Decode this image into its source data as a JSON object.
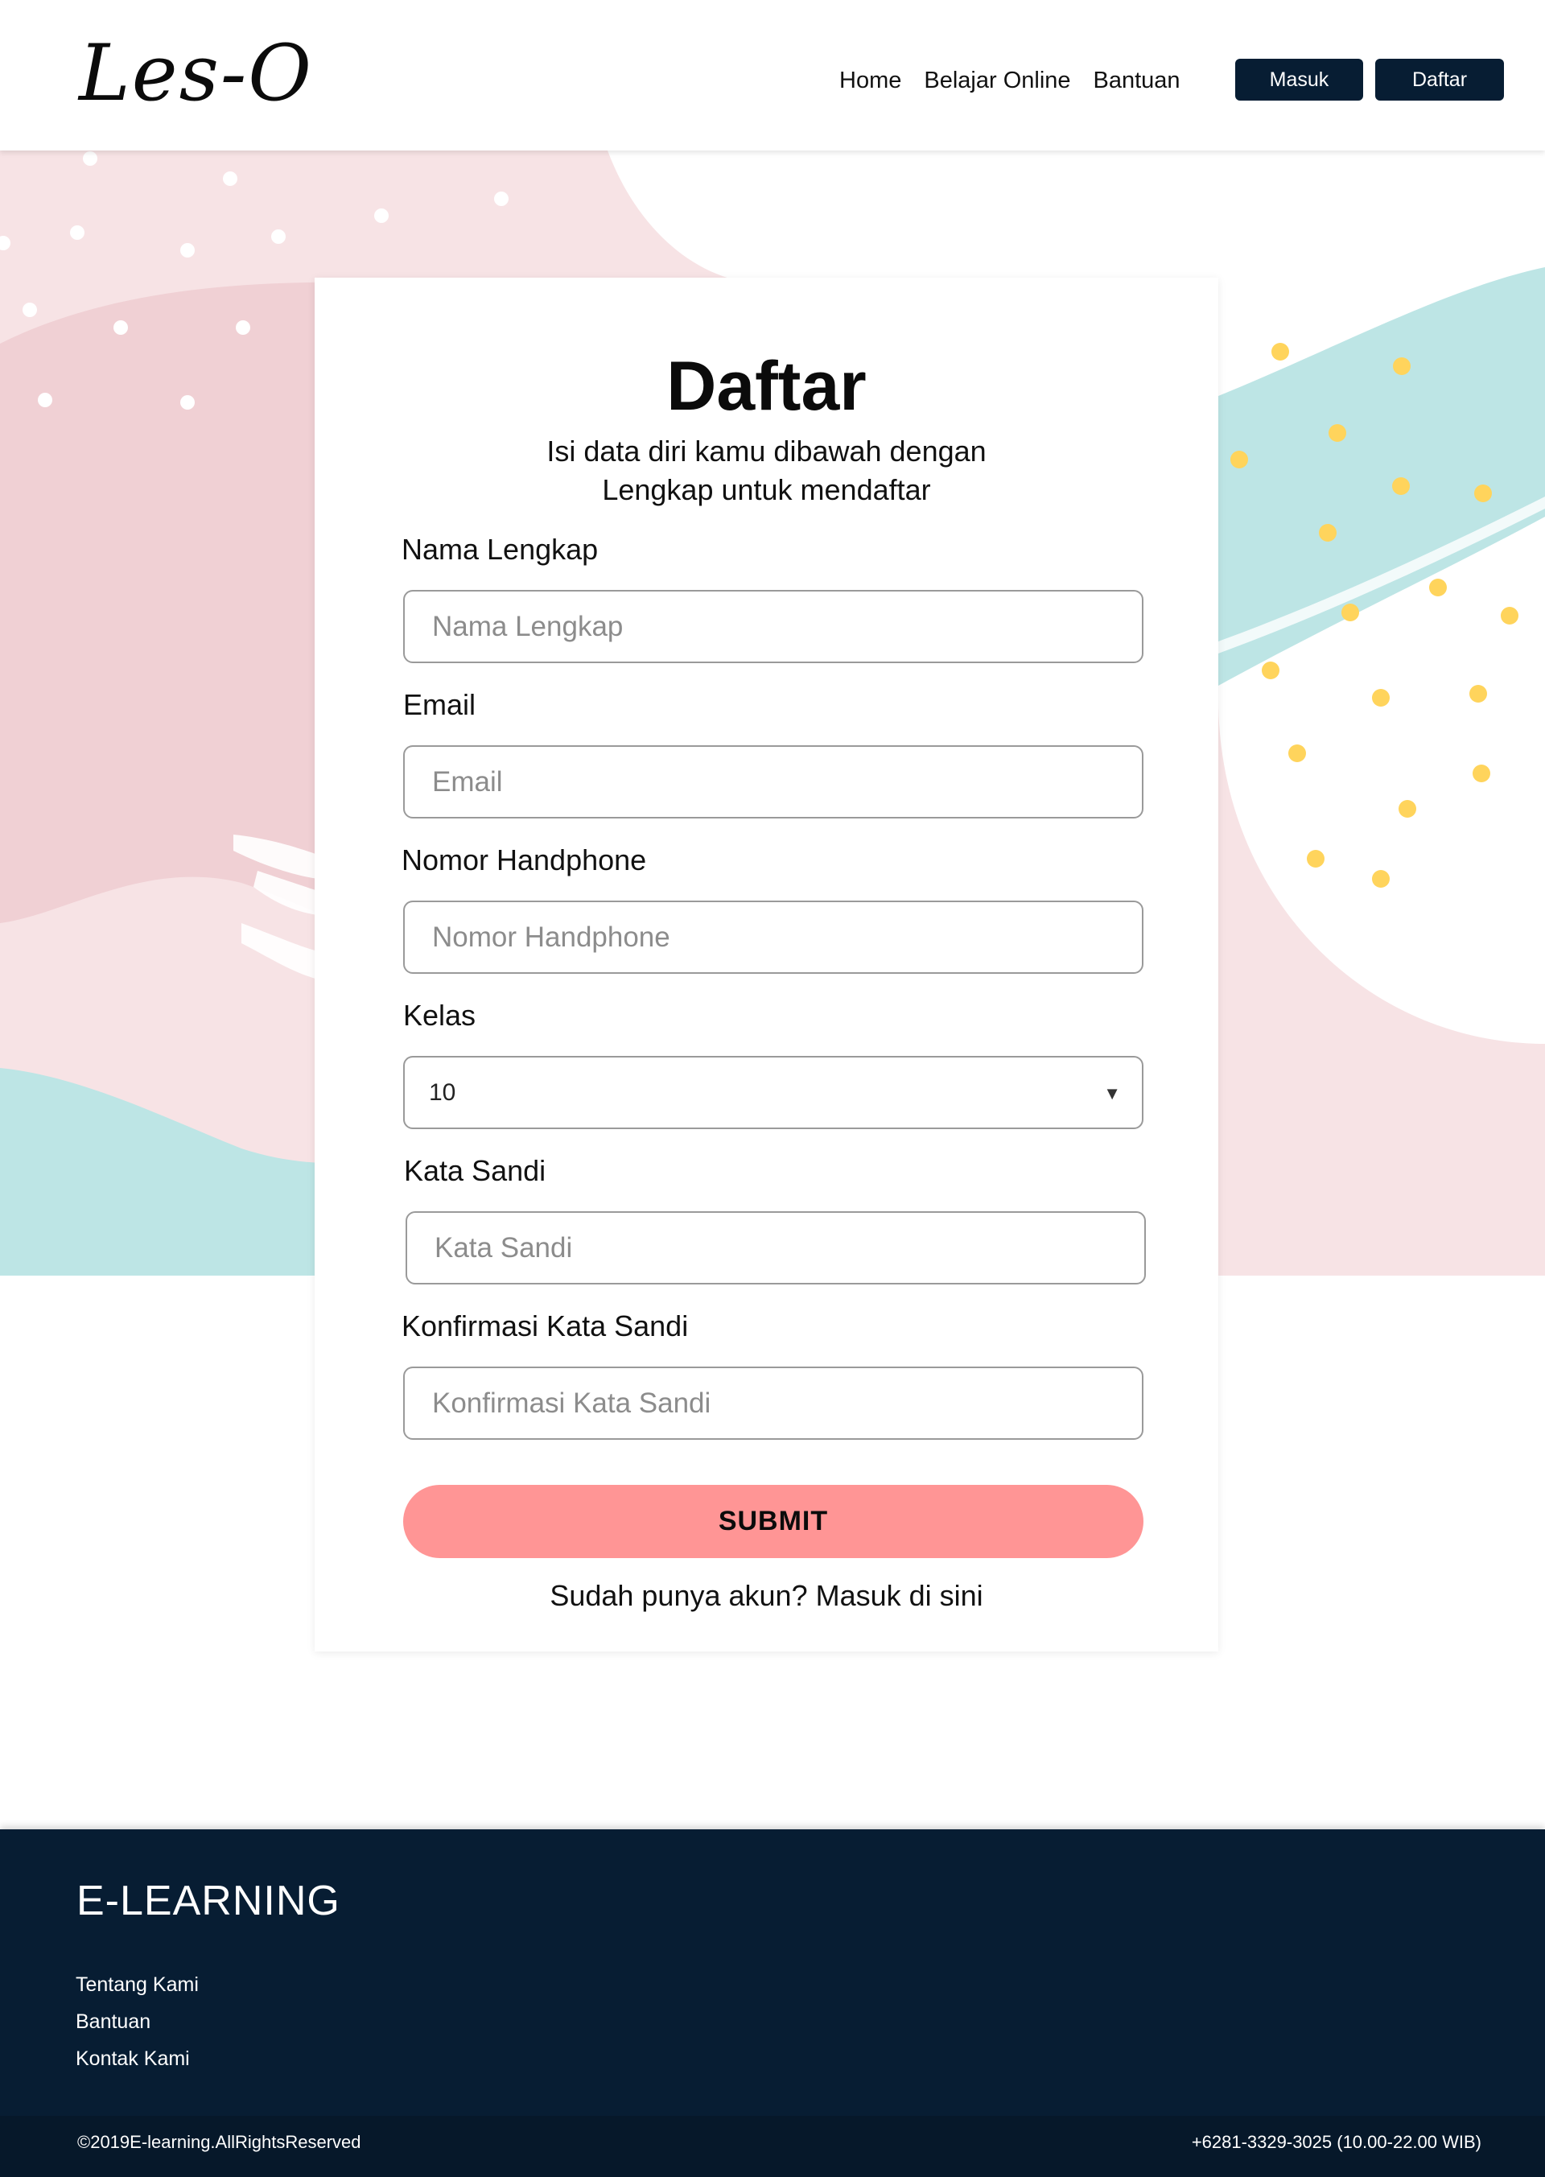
{
  "header": {
    "logo": "Les-O",
    "nav": [
      "Home",
      "Belajar Online",
      "Bantuan"
    ],
    "login_button": "Masuk",
    "register_button": "Daftar"
  },
  "form": {
    "title": "Daftar",
    "subtitle_line1": "Isi data diri kamu dibawah dengan",
    "subtitle_line2": "Lengkap untuk mendaftar",
    "fields": {
      "name": {
        "label": "Nama Lengkap",
        "placeholder": "Nama Lengkap",
        "value": ""
      },
      "email": {
        "label": "Email",
        "placeholder": "Email",
        "value": ""
      },
      "phone": {
        "label": "Nomor Handphone",
        "placeholder": "Nomor Handphone",
        "value": ""
      },
      "class": {
        "label": "Kelas",
        "selected": "10"
      },
      "password": {
        "label": "Kata Sandi",
        "placeholder": "Kata Sandi",
        "value": ""
      },
      "confirm": {
        "label": "Konfirmasi Kata Sandi",
        "placeholder": "Konfirmasi Kata Sandi",
        "value": ""
      }
    },
    "submit_label": "SUBMIT",
    "login_prompt": "Sudah punya akun? Masuk di sini"
  },
  "footer": {
    "brand": "E-LEARNING",
    "links": [
      "Tentang Kami",
      "Bantuan",
      "Kontak Kami"
    ],
    "copyright": "©2019E-learning.AllRightsReserved",
    "contact": "+6281-3329-3025 (10.00-22.00 WIB)"
  },
  "colors": {
    "navy": "#071d33",
    "pink_light": "#f7e3e5",
    "pink": "#f0d0d4",
    "teal": "#bde5e5",
    "yellow_dot": "#ffd45c",
    "submit": "#ff9595"
  },
  "icons": {
    "select_arrow": "triangle-down-icon"
  }
}
